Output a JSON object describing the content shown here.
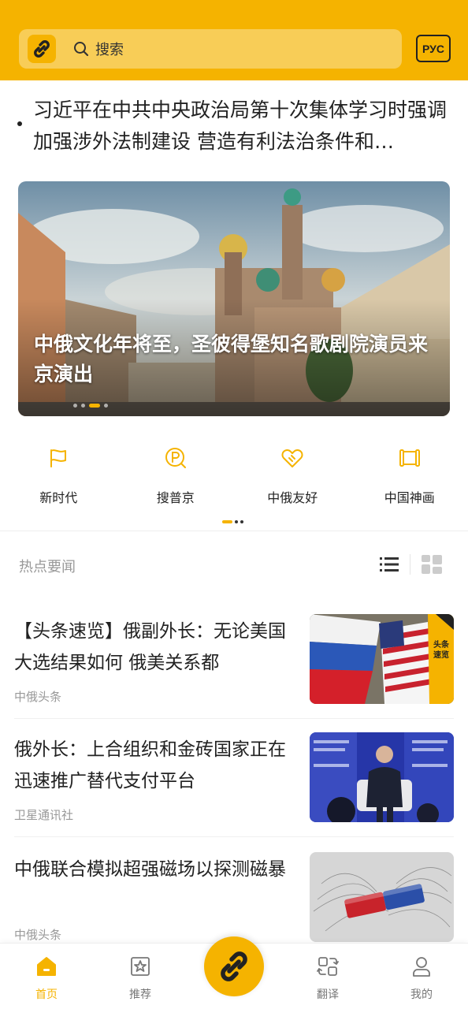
{
  "header": {
    "search_placeholder": "搜索",
    "lang_button": "РУС",
    "brand_color": "#f5b300"
  },
  "top_headline": {
    "text": "习近平在中共中央政治局第十次集体学习时强调 加强涉外法制建设 营造有利法治条件和…"
  },
  "banner": {
    "title": "中俄文化年将至，圣彼得堡知名歌剧院演员来京演出",
    "slide_count": 4,
    "active_slide": 3
  },
  "quick_nav": {
    "items": [
      {
        "label": "新时代",
        "icon": "flag-icon"
      },
      {
        "label": "搜普京",
        "icon": "search-p-icon"
      },
      {
        "label": "中俄友好",
        "icon": "handshake-heart-icon"
      },
      {
        "label": "中国神画",
        "icon": "scroll-icon"
      }
    ],
    "page_count": 2,
    "active_page": 1
  },
  "section": {
    "title": "热点要闻"
  },
  "news": [
    {
      "title": "【头条速览】俄副外长：无论美国大选结果如何 俄美关系都",
      "source": "中俄头条",
      "thumb": "flags-image",
      "thumb_badge": "头条速览"
    },
    {
      "title": "俄外长：上合组织和金砖国家正在迅速推广替代支付平台",
      "source": "卫星通讯社",
      "thumb": "speaker-image"
    },
    {
      "title": "中俄联合模拟超强磁场以探测磁暴",
      "source": "中俄头条",
      "thumb": "magnet-image"
    }
  ],
  "tabs": [
    {
      "label": "首页",
      "icon": "home-icon",
      "active": true
    },
    {
      "label": "推荐",
      "icon": "star-bookmark-icon",
      "active": false
    },
    {
      "label": "翻译",
      "icon": "translate-icon",
      "active": false
    },
    {
      "label": "我的",
      "icon": "user-icon",
      "active": false
    }
  ]
}
